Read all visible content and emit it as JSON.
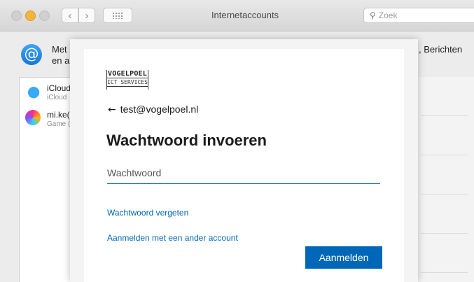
{
  "window": {
    "title": "Internetaccounts",
    "search_placeholder": "Zoek"
  },
  "background": {
    "intro_line1": "Met",
    "intro_line2": "en a",
    "intro_right": ", Berichten",
    "accounts": [
      {
        "name": "iCloud",
        "sub": "iCloud",
        "icon": "icloud-icon"
      },
      {
        "name": "mi.ke(",
        "sub": "Game (",
        "icon": "game-center-icon"
      }
    ]
  },
  "signin": {
    "logo_line1": "VOGELPOEL",
    "logo_line2": "ICT SERVICES",
    "back_email": "test@vogelpoel.nl",
    "heading": "Wachtwoord invoeren",
    "password_placeholder": "Wachtwoord",
    "forgot_link": "Wachtwoord vergeten",
    "other_account_link": "Aanmelden met een ander account",
    "submit_label": "Aanmelden",
    "accent_color": "#0067b8"
  }
}
